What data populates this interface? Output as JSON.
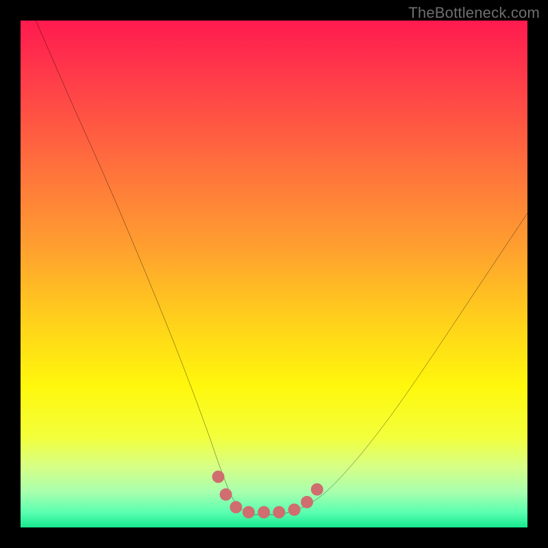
{
  "watermark": "TheBottleneck.com",
  "chart_data": {
    "type": "line",
    "title": "",
    "xlabel": "",
    "ylabel": "",
    "xlim": [
      0,
      100
    ],
    "ylim": [
      0,
      100
    ],
    "background_gradient": {
      "stops": [
        {
          "pos": 0.0,
          "color": "#ff1a4f"
        },
        {
          "pos": 0.12,
          "color": "#ff3e49"
        },
        {
          "pos": 0.28,
          "color": "#ff6e3d"
        },
        {
          "pos": 0.45,
          "color": "#ffa02f"
        },
        {
          "pos": 0.6,
          "color": "#ffd31a"
        },
        {
          "pos": 0.72,
          "color": "#fff70c"
        },
        {
          "pos": 0.82,
          "color": "#f3ff3a"
        },
        {
          "pos": 0.88,
          "color": "#d7ff86"
        },
        {
          "pos": 0.93,
          "color": "#a8ffae"
        },
        {
          "pos": 0.97,
          "color": "#5bffb0"
        },
        {
          "pos": 1.0,
          "color": "#17e890"
        }
      ]
    },
    "series": [
      {
        "name": "bottleneck-curve",
        "color": "#000000",
        "width": 2,
        "x": [
          3,
          10,
          18,
          26,
          32,
          36.5,
          39.5,
          42,
          44.5,
          47.5,
          53,
          59,
          65.5,
          73,
          81,
          90,
          97,
          100
        ],
        "y": [
          100,
          84,
          66,
          47,
          32,
          20,
          11.5,
          5.5,
          3,
          2.5,
          3,
          6,
          12.5,
          22,
          33.5,
          47,
          57.5,
          62
        ]
      },
      {
        "name": "highlight-markers",
        "color": "#cf6d6f",
        "type": "scatter",
        "radius": 9,
        "x": [
          39,
          40.5,
          42.5,
          45,
          48,
          51,
          54,
          56.5,
          58.5
        ],
        "y": [
          10,
          6.5,
          4,
          3,
          3,
          3,
          3.5,
          5,
          7.5
        ]
      }
    ]
  }
}
